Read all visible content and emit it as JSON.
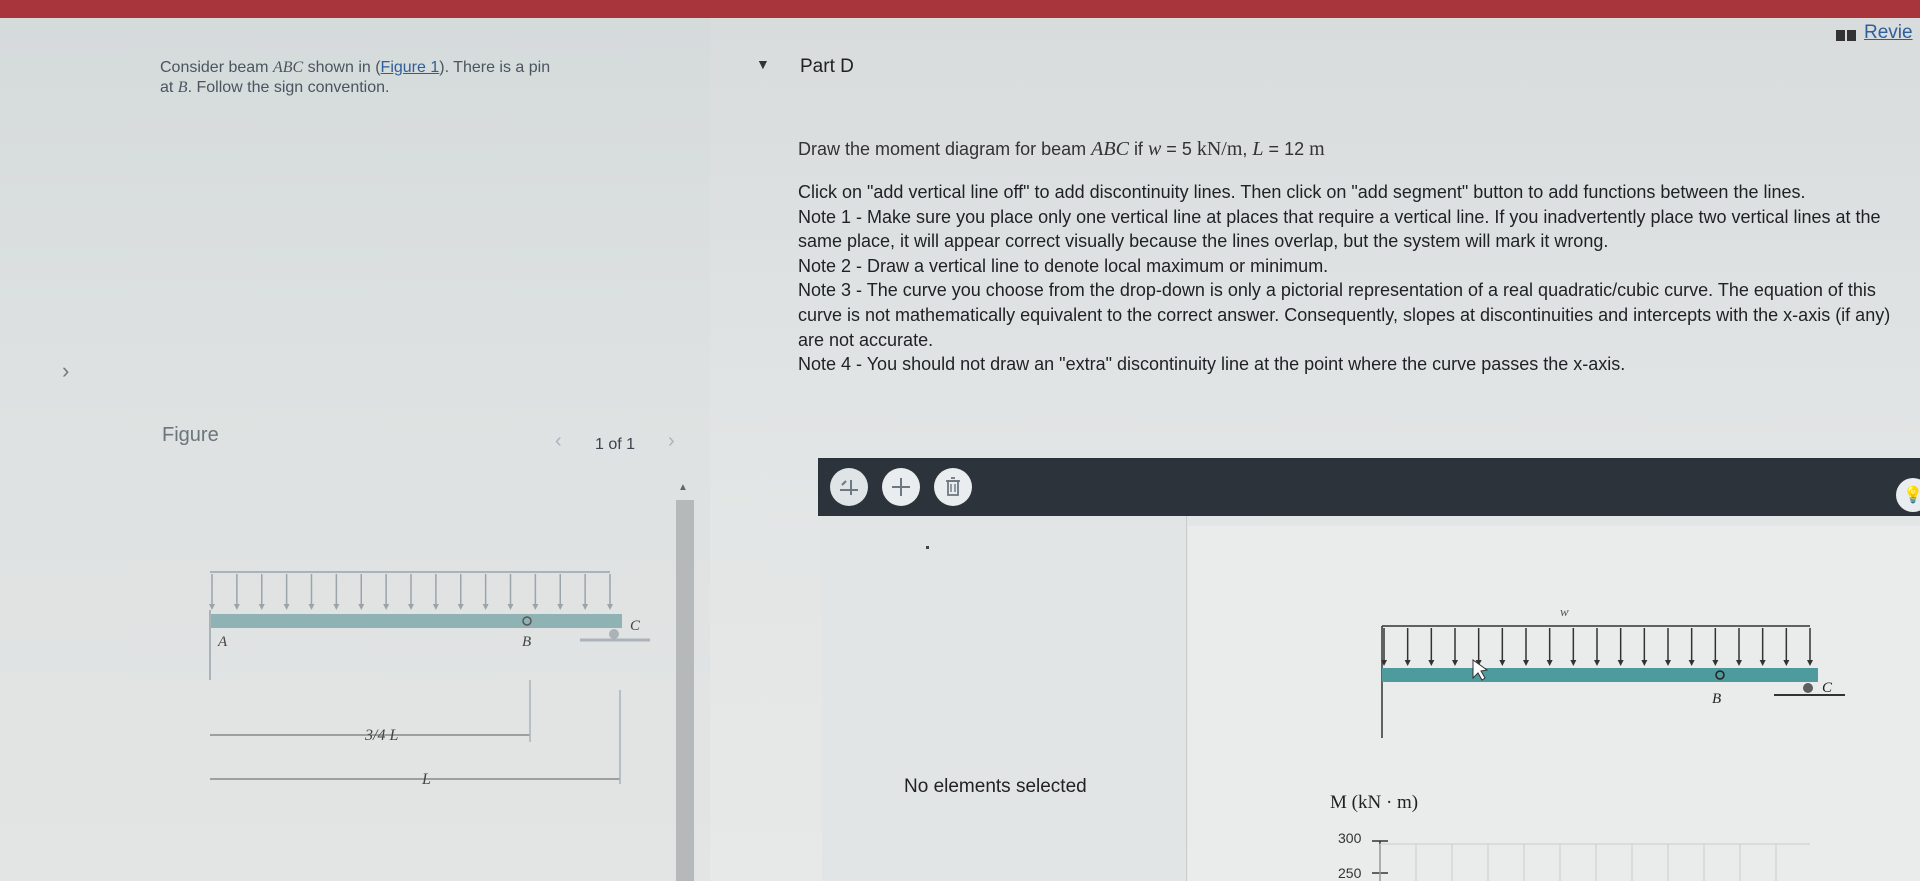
{
  "left": {
    "intro_line1": "Consider beam ABC shown in (Figure 1). There is a pin",
    "intro_line2": "at B. Follow the sign convention.",
    "figure_label": "Figure",
    "pager_text": "1 of 1",
    "figure": {
      "label_A": "A",
      "label_B": "B",
      "label_C": "C",
      "dim_three_quarter": "3/4 L",
      "dim_L": "L"
    }
  },
  "part": {
    "toggle_icon": "caret-down",
    "title": "Part D",
    "review_label": "Revie"
  },
  "question": {
    "prefix": "Draw the moment diagram for beam",
    "beam": "ABC",
    "if_text": "if",
    "w_var": "w",
    "w_val": "5",
    "w_unit": "kN/m",
    "L_var": "L",
    "L_val": "12",
    "L_unit": "m"
  },
  "instructions": [
    "Click on \"add vertical line off\" to add discontinuity lines. Then click on \"add segment\" button to add functions between the lines.",
    "Note 1 - Make sure you place only one vertical line at places that require a vertical line. If you inadvertently place two vertical lines at the same place, it will appear correct visually because the lines overlap, but the system will mark it wrong.",
    "Note 2 - Draw a vertical line to denote local maximum or minimum.",
    "Note 3 - The curve you choose from the drop-down is only a pictorial representation of a real quadratic/cubic curve. The equation of this curve is not mathematically equivalent to the correct answer. Consequently, slopes at discontinuities and intercepts with the x-axis (if any) are not accurate.",
    "Note 4 - You should not draw an \"extra\" discontinuity line at the point where the curve passes the x-axis."
  ],
  "toolbar": {
    "buttons": [
      {
        "name": "add-vertical-line-icon"
      },
      {
        "name": "add-segment-icon"
      },
      {
        "name": "delete-icon"
      }
    ]
  },
  "panel": {
    "no_selection": "No elements selected"
  },
  "canvas": {
    "load_label": "w",
    "label_B": "B",
    "label_C": "C",
    "y_axis_label": "M (kN · m)",
    "ticks": [
      "300",
      "250"
    ]
  },
  "colors": {
    "header_red": "#a8343c",
    "toolbar_dark": "#2d333a",
    "beam_teal": "#4e9b9d",
    "link_blue": "#2f5f9a"
  }
}
